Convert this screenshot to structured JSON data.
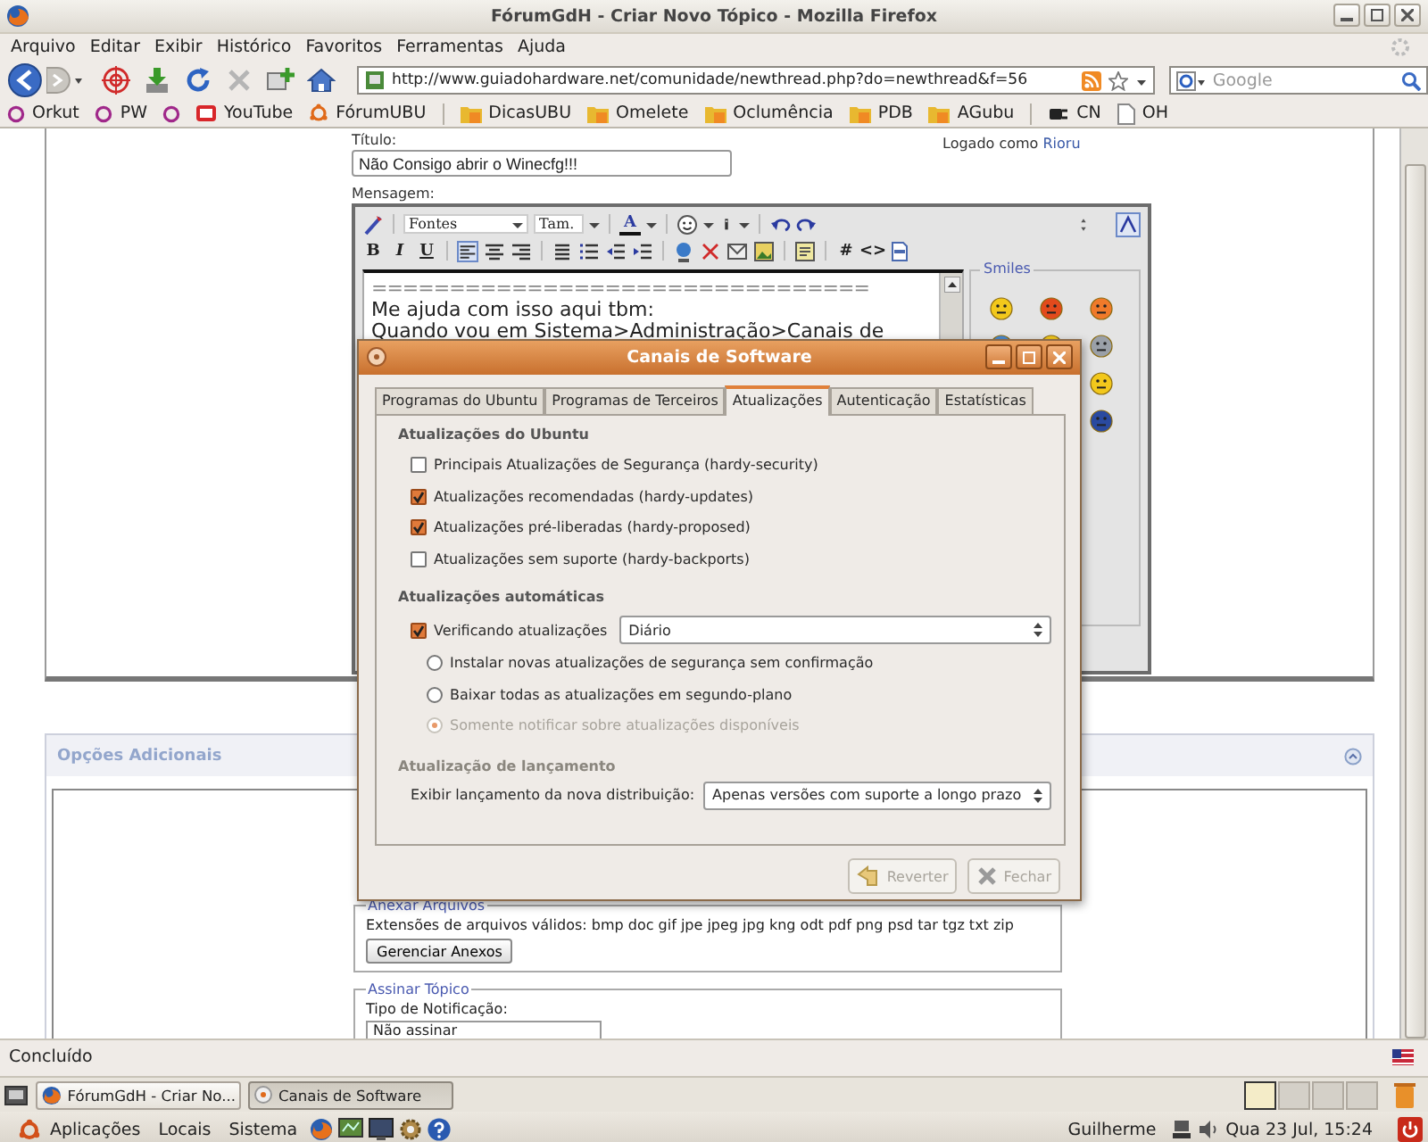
{
  "window": {
    "title": "FórumGdH - Criar Novo Tópico - Mozilla Firefox"
  },
  "menu": [
    "Arquivo",
    "Editar",
    "Exibir",
    "Histórico",
    "Favoritos",
    "Ferramentas",
    "Ajuda"
  ],
  "address": {
    "value": "http://www.guiadohardware.net/comunidade/newthread.php?do=newthread&f=56"
  },
  "search": {
    "placeholder": "Google"
  },
  "bookmarks": [
    {
      "kind": "ring",
      "label": "Orkut"
    },
    {
      "kind": "ring",
      "label": "PW"
    },
    {
      "kind": "ring"
    },
    {
      "kind": "youtube",
      "label": "YouTube"
    },
    {
      "kind": "ubuntu",
      "label": "FórumUBU"
    },
    {
      "kind": "separator"
    },
    {
      "kind": "feed",
      "label": "DicasUBU"
    },
    {
      "kind": "feed",
      "label": "Omelete"
    },
    {
      "kind": "feed",
      "label": "Oclumência"
    },
    {
      "kind": "feed",
      "label": "PDB"
    },
    {
      "kind": "feed",
      "label": "AGubu"
    },
    {
      "kind": "separator"
    },
    {
      "kind": "plug",
      "label": "CN"
    },
    {
      "kind": "page",
      "label": "OH"
    }
  ],
  "page": {
    "title_label": "Título:",
    "title_value": "Não Consigo abrir o Winecfg!!!",
    "login_label": "Logado como",
    "login_user": "Rioru",
    "message_label": "Mensagem:",
    "editor": {
      "font": "Fontes",
      "size": "Tam.",
      "color_button": "A",
      "format_buttons": [
        "B",
        "I",
        "U"
      ],
      "align_buttons": [
        {
          "selected": true
        },
        {
          "selected": false
        },
        {
          "selected": false
        }
      ],
      "code_buttons": [
        "#",
        "<>"
      ],
      "lines": [
        "================================",
        "Me ajuda com isso aqui tbm:",
        "Quando vou em Sistema>Administração>Canais de"
      ],
      "smiles_title": "Smiles"
    },
    "options_title": "Opções Adicionais",
    "attach": {
      "legend": "Anexar Arquivos",
      "text": "Extensões de arquivos válidos: bmp doc gif jpe jpeg jpg kng odt pdf png psd tar tgz txt zip",
      "button": "Gerenciar Anexos"
    },
    "subscribe": {
      "legend": "Assinar Tópico",
      "label": "Tipo de Notificação:",
      "value": "Não assinar"
    }
  },
  "dialog": {
    "title": "Canais de Software",
    "tabs": [
      {
        "label": "Programas do Ubuntu",
        "selected": false
      },
      {
        "label": "Programas de Terceiros",
        "selected": false
      },
      {
        "label": "Atualizações",
        "selected": true
      },
      {
        "label": "Autenticação",
        "selected": false
      },
      {
        "label": "Estatísticas",
        "selected": false
      }
    ],
    "ubuntu_section": "Atualizações do Ubuntu",
    "checks": [
      {
        "label": "Principais Atualizações de Segurança (hardy-security)",
        "checked": false
      },
      {
        "label": "Atualizações recomendadas (hardy-updates)",
        "checked": true
      },
      {
        "label": "Atualizações pré-liberadas (hardy-proposed)",
        "checked": true
      },
      {
        "label": "Atualizações sem suporte (hardy-backports)",
        "checked": false
      }
    ],
    "auto_section": "Atualizações automáticas",
    "auto_check": {
      "label": "Verificando atualizações",
      "checked": true
    },
    "frequency": "Diário",
    "radios": [
      {
        "label": "Instalar novas atualizações de segurança sem confirmação",
        "selected": false,
        "disabled": false
      },
      {
        "label": "Baixar todas as atualizações em segundo-plano",
        "selected": false,
        "disabled": false
      },
      {
        "label": "Somente notificar sobre atualizações disponíveis",
        "selected": true,
        "disabled": true
      }
    ],
    "release_section": "Atualização de lançamento",
    "release_label": "Exibir lançamento da nova distribuição:",
    "release_value": "Apenas versões com suporte a longo prazo",
    "buttons": [
      {
        "kind": "revert",
        "label": "Reverter",
        "disabled": true
      },
      {
        "kind": "close",
        "label": "Fechar",
        "disabled": true
      }
    ]
  },
  "status_bar": {
    "text": "Concluído"
  },
  "taskbar": [
    {
      "label": "FórumGdH - Criar No...",
      "selected": false
    },
    {
      "label": "Canais de Software",
      "selected": true
    }
  ],
  "panel": {
    "menus": [
      "Aplicações",
      "Locais",
      "Sistema"
    ],
    "user": "Guilherme",
    "clock": "Qua 23 Jul, 15:24"
  }
}
